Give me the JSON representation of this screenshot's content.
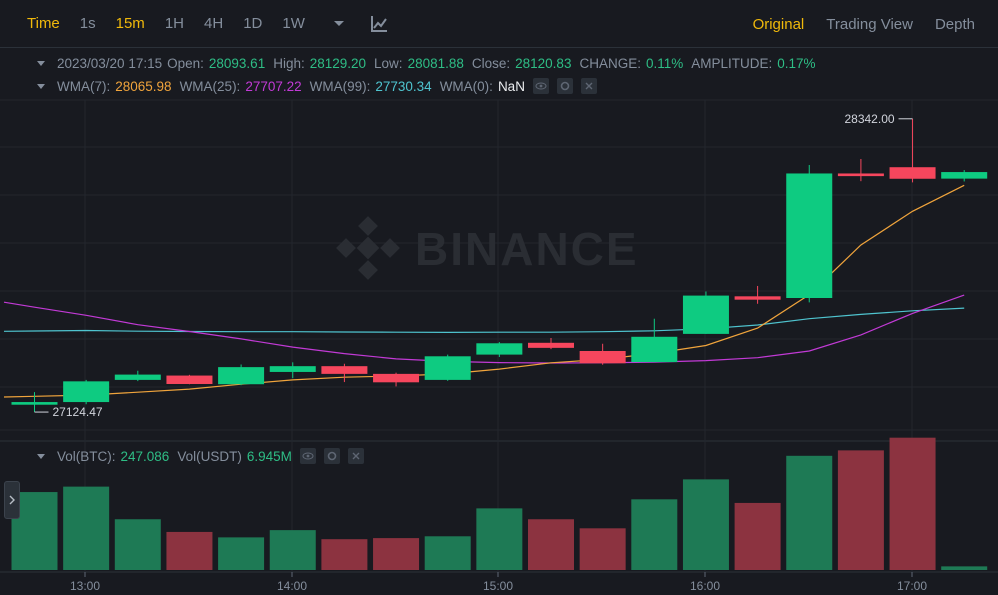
{
  "toolbar": {
    "time_label": "Time",
    "intervals": [
      "1s",
      "15m",
      "1H",
      "4H",
      "1D",
      "1W"
    ],
    "active_interval": "15m",
    "dropdown_icon": "chevron-down-icon",
    "indicator_icon": "chart-indicator-icon",
    "views": [
      "Original",
      "Trading View",
      "Depth"
    ],
    "active_view": "Original"
  },
  "ohlc": {
    "datetime": "2023/03/20 17:15",
    "open_label": "Open:",
    "open": "28093.61",
    "high_label": "High:",
    "high": "28129.20",
    "low_label": "Low:",
    "low": "28081.88",
    "close_label": "Close:",
    "close": "28120.83",
    "change_label": "CHANGE:",
    "change": "0.11%",
    "amplitude_label": "AMPLITUDE:",
    "amplitude": "0.17%"
  },
  "wma": {
    "wma7_label": "WMA(7):",
    "wma7": "28065.98",
    "wma25_label": "WMA(25):",
    "wma25": "27707.22",
    "wma99_label": "WMA(99):",
    "wma99": "27730.34",
    "wma0_label": "WMA(0):",
    "wma0": "NaN"
  },
  "vol": {
    "btc_label": "Vol(BTC):",
    "btc": "247.086",
    "usdt_label": "Vol(USDT)",
    "usdt": "6.945M"
  },
  "watermark": "BINANCE",
  "colors": {
    "up": "#0ecb81",
    "down": "#f6465d",
    "vol_up": "#1e7a55",
    "vol_down": "#8c3340",
    "wma7": "#f0a43c",
    "wma25": "#c23ad6",
    "wma99": "#4fc4cf",
    "bg": "#181a20",
    "grid": "#23262d"
  },
  "chart_data": {
    "type": "candlestick",
    "interval": "15m",
    "x_ticks": [
      "13:00",
      "14:00",
      "15:00",
      "16:00",
      "17:00"
    ],
    "y_range": [
      27050,
      28420
    ],
    "candles": [
      {
        "o": 27155,
        "h": 27207,
        "l": 27124.47,
        "c": 27166
      },
      {
        "o": 27166,
        "h": 27258,
        "l": 27157,
        "c": 27252
      },
      {
        "o": 27258,
        "h": 27296,
        "l": 27253,
        "c": 27280
      },
      {
        "o": 27276,
        "h": 27279,
        "l": 27240,
        "c": 27241
      },
      {
        "o": 27240,
        "h": 27322,
        "l": 27236,
        "c": 27311
      },
      {
        "o": 27291,
        "h": 27331,
        "l": 27265,
        "c": 27315
      },
      {
        "o": 27315,
        "h": 27325,
        "l": 27249,
        "c": 27283
      },
      {
        "o": 27283,
        "h": 27288,
        "l": 27231,
        "c": 27248
      },
      {
        "o": 27258,
        "h": 27363,
        "l": 27254,
        "c": 27356
      },
      {
        "o": 27363,
        "h": 27415,
        "l": 27353,
        "c": 27410
      },
      {
        "o": 27412,
        "h": 27432,
        "l": 27386,
        "c": 27391
      },
      {
        "o": 27378,
        "h": 27408,
        "l": 27321,
        "c": 27327
      },
      {
        "o": 27332,
        "h": 27512,
        "l": 27332,
        "c": 27437
      },
      {
        "o": 27449,
        "h": 27625,
        "l": 27449,
        "c": 27608
      },
      {
        "o": 27605,
        "h": 27648,
        "l": 27574,
        "c": 27591
      },
      {
        "o": 27598,
        "h": 28150,
        "l": 27580,
        "c": 28115
      },
      {
        "o": 28115,
        "h": 28175,
        "l": 28083,
        "c": 28104
      },
      {
        "o": 28141,
        "h": 28342.0,
        "l": 28078,
        "c": 28093
      },
      {
        "o": 28093.61,
        "h": 28129.2,
        "l": 28081.88,
        "c": 28120.83
      }
    ],
    "volumes": [
      215,
      230,
      140,
      105,
      90,
      110,
      85,
      88,
      93,
      170,
      140,
      115,
      195,
      250,
      185,
      315,
      330,
      365,
      10
    ],
    "wma7": [
      27190,
      27195,
      27207,
      27220,
      27240,
      27258,
      27269,
      27274,
      27283,
      27303,
      27329,
      27343,
      27368,
      27401,
      27473,
      27612,
      27818,
      27958,
      28066
    ],
    "wma25": [
      27560,
      27526,
      27487,
      27459,
      27428,
      27394,
      27367,
      27345,
      27335,
      27330,
      27328,
      27329,
      27332,
      27338,
      27350,
      27378,
      27445,
      27534,
      27610
    ],
    "wma99": [
      27461,
      27463,
      27460,
      27459,
      27458,
      27458,
      27457,
      27456,
      27455,
      27456,
      27456,
      27458,
      27462,
      27470,
      27486,
      27512,
      27530,
      27545,
      27556
    ],
    "annotations": {
      "high": "28342.00",
      "low": "27124.47"
    }
  }
}
